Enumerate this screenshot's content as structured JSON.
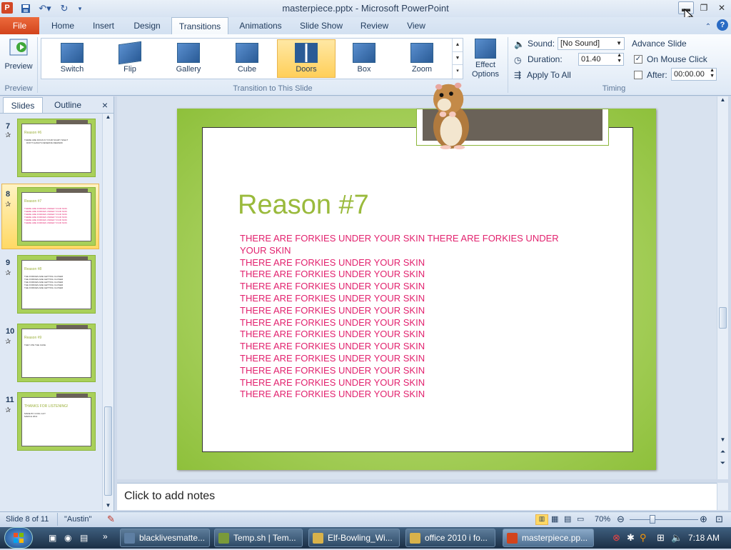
{
  "window": {
    "title": "masterpiece.pptx - Microsoft PowerPoint",
    "app_icon_letter": "P"
  },
  "ribbon_tabs": {
    "file": "File",
    "home": "Home",
    "insert": "Insert",
    "design": "Design",
    "transitions": "Transitions",
    "animations": "Animations",
    "slide_show": "Slide Show",
    "review": "Review",
    "view": "View"
  },
  "ribbon": {
    "preview_label": "Preview",
    "preview_group": "Preview",
    "transitions": [
      "Switch",
      "Flip",
      "Gallery",
      "Cube",
      "Doors",
      "Box",
      "Zoom"
    ],
    "selected_transition": "Doors",
    "effect_options": "Effect Options",
    "transition_group": "Transition to This Slide",
    "sound_label": "Sound:",
    "sound_value": "[No Sound]",
    "duration_label": "Duration:",
    "duration_value": "01.40",
    "apply_to_all": "Apply To All",
    "advance_slide": "Advance Slide",
    "on_mouse_click": "On Mouse Click",
    "on_mouse_click_checked": true,
    "after_label": "After:",
    "after_value": "00:00.00",
    "after_checked": false,
    "timing_group": "Timing"
  },
  "left_panel": {
    "tab_slides": "Slides",
    "tab_outline": "Outline",
    "close": "×",
    "thumbnails": [
      {
        "num": "7",
        "title": "Reason #6",
        "lines": [
          "THERE ARE DOGS IN YOUR SCARY NIGHT",
          "DON'T ALWAYS DESERVE REWARD"
        ]
      },
      {
        "num": "8",
        "title": "Reason #7",
        "lines": [
          "THERE ARE FORKIES UNDER YOUR SKIN",
          "THERE ARE FORKIES UNDER YOUR SKIN",
          "THERE ARE FORKIES UNDER YOUR SKIN",
          "THERE ARE FORKIES UNDER YOUR SKIN",
          "THERE ARE FORKIES UNDER YOUR SKIN",
          "THERE ARE FORKIES UNDER YOUR SKIN"
        ],
        "selected": true
      },
      {
        "num": "9",
        "title": "Reason #8",
        "lines": [
          "THE FORKIES ARE GETTING CLOSER",
          "THE FORKIES ARE GETTING CLOSER",
          "THE FORKIES ARE GETTING CLOSER",
          "THE FORKIES ARE GETTING CLOSER",
          "THE FORKIES ARE GETTING CLOSER"
        ]
      },
      {
        "num": "10",
        "title": "Reason #9",
        "lines": [
          "THEY ATE THE CAKE"
        ]
      },
      {
        "num": "11",
        "title": "THANKS FOR LISTENING!",
        "lines": [
          "MADE BY COOL GUY",
          "MARCH 2011"
        ]
      }
    ]
  },
  "slide": {
    "title": "Reason #7",
    "lines": [
      "THERE ARE FORKIES UNDER YOUR SKIN THERE ARE FORKIES UNDER YOUR SKIN",
      "THERE ARE FORKIES UNDER YOUR SKIN",
      "THERE ARE FORKIES UNDER YOUR SKIN",
      "THERE ARE FORKIES UNDER YOUR SKIN",
      "THERE ARE FORKIES UNDER YOUR SKIN",
      "THERE ARE FORKIES UNDER YOUR SKIN",
      "THERE ARE FORKIES UNDER YOUR SKIN",
      "THERE ARE FORKIES UNDER YOUR SKIN",
      "THERE ARE FORKIES UNDER YOUR SKIN",
      "THERE ARE FORKIES UNDER YOUR SKIN",
      "THERE ARE FORKIES UNDER YOUR SKIN",
      "THERE ARE FORKIES UNDER YOUR SKIN",
      "THERE ARE FORKIES UNDER YOUR SKIN"
    ]
  },
  "notes": {
    "placeholder": "Click to add notes"
  },
  "status": {
    "slide_info": "Slide 8 of 11",
    "theme": "\"Austin\"",
    "zoom": "70%"
  },
  "taskbar": {
    "items": [
      "blacklivesmatte...",
      "Temp.sh | Tem...",
      "Elf-Bowling_Wi...",
      "office 2010 i fo...",
      "masterpiece.pp..."
    ],
    "clock": "7:18 AM"
  },
  "colors": {
    "accent_orange": "#d2441c",
    "slide_green": "#9aba3c",
    "body_pink": "#e2226e",
    "selection_gold": "#ffcf5a"
  }
}
